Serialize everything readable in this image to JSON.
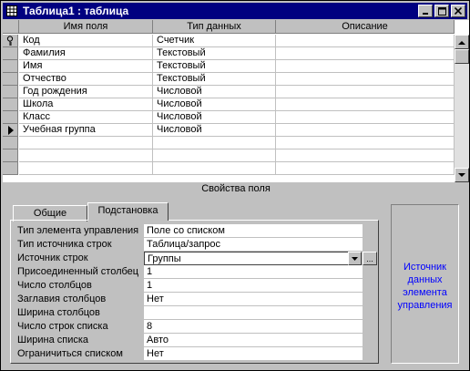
{
  "window": {
    "title": "Таблица1 : таблица",
    "icon": "table-icon",
    "buttons": [
      "minimize-icon",
      "maximize-icon",
      "close-icon"
    ]
  },
  "grid": {
    "columns": [
      "Имя поля",
      "Тип данных",
      "Описание"
    ],
    "rows": [
      {
        "name": "Код",
        "type": "Счетчик",
        "description": "",
        "marker": "key-icon"
      },
      {
        "name": "Фамилия",
        "type": "Текстовый",
        "description": "",
        "marker": ""
      },
      {
        "name": "Имя",
        "type": "Текстовый",
        "description": "",
        "marker": ""
      },
      {
        "name": "Отчество",
        "type": "Текстовый",
        "description": "",
        "marker": ""
      },
      {
        "name": "Год рождения",
        "type": "Числовой",
        "description": "",
        "marker": ""
      },
      {
        "name": "Школа",
        "type": "Числовой",
        "description": "",
        "marker": ""
      },
      {
        "name": "Класс",
        "type": "Числовой",
        "description": "",
        "marker": ""
      },
      {
        "name": "Учебная группа",
        "type": "Числовой",
        "description": "",
        "marker": "current-row-arrow-icon"
      }
    ]
  },
  "properties": {
    "title": "Свойства поля",
    "tabs": [
      "Общие",
      "Подстановка"
    ],
    "active_tab": "Подстановка",
    "rows": [
      {
        "label": "Тип элемента управления",
        "value": "Поле со списком"
      },
      {
        "label": "Тип источника строк",
        "value": "Таблица/запрос"
      },
      {
        "label": "Источник строк",
        "value": "Группы"
      },
      {
        "label": "Присоединенный столбец",
        "value": "1"
      },
      {
        "label": "Число столбцов",
        "value": "1"
      },
      {
        "label": "Заглавия столбцов",
        "value": "Нет"
      },
      {
        "label": "Ширина столбцов",
        "value": ""
      },
      {
        "label": "Число строк списка",
        "value": "8"
      },
      {
        "label": "Ширина списка",
        "value": "Авто"
      },
      {
        "label": "Ограничиться списком",
        "value": "Нет"
      }
    ],
    "builder_button": "...",
    "hint": "Источник данных элемента управления"
  },
  "colors": {
    "titlebar": "#000080",
    "hint_text": "#0000ff",
    "face": "#c0c0c0"
  }
}
